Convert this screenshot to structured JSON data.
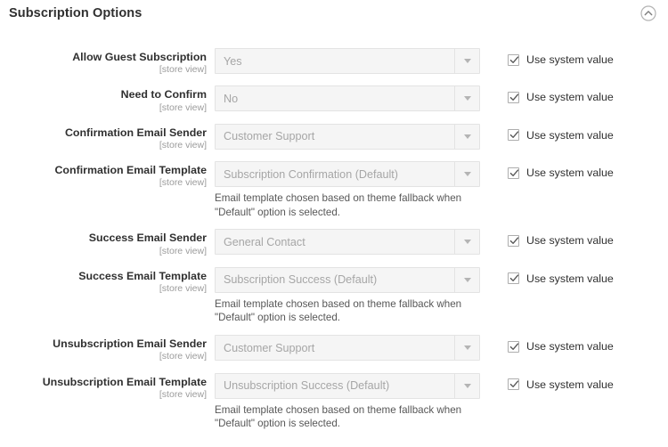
{
  "section": {
    "title": "Subscription Options",
    "collapse_icon": "chevron-up-circle-icon",
    "collapsed": false
  },
  "scope_label": "[store view]",
  "checkbox_label": "Use system value",
  "template_note": "Email template chosen based on theme fallback when \"Default\" option is selected.",
  "colors": {
    "text": "#303030",
    "muted": "#9b9b9b",
    "select_bg": "#f5f5f5",
    "select_border": "#e3e3e3",
    "select_value": "#a6a6a6",
    "note": "#575757"
  },
  "fields": [
    {
      "label": "Allow Guest Subscription",
      "scope": "[store view]",
      "value": "Yes",
      "note": null,
      "use_system_value": true,
      "checkbox_label": "Use system value"
    },
    {
      "label": "Need to Confirm",
      "scope": "[store view]",
      "value": "No",
      "note": null,
      "use_system_value": true,
      "checkbox_label": "Use system value"
    },
    {
      "label": "Confirmation Email Sender",
      "scope": "[store view]",
      "value": "Customer Support",
      "note": null,
      "use_system_value": true,
      "checkbox_label": "Use system value"
    },
    {
      "label": "Confirmation Email Template",
      "scope": "[store view]",
      "value": "Subscription Confirmation (Default)",
      "note": "Email template chosen based on theme fallback when \"Default\" option is selected.",
      "use_system_value": true,
      "checkbox_label": "Use system value"
    },
    {
      "label": "Success Email Sender",
      "scope": "[store view]",
      "value": "General Contact",
      "note": null,
      "use_system_value": true,
      "checkbox_label": "Use system value"
    },
    {
      "label": "Success Email Template",
      "scope": "[store view]",
      "value": "Subscription Success (Default)",
      "note": "Email template chosen based on theme fallback when \"Default\" option is selected.",
      "use_system_value": true,
      "checkbox_label": "Use system value"
    },
    {
      "label": "Unsubscription Email Sender",
      "scope": "[store view]",
      "value": "Customer Support",
      "note": null,
      "use_system_value": true,
      "checkbox_label": "Use system value"
    },
    {
      "label": "Unsubscription Email Template",
      "scope": "[store view]",
      "value": "Unsubscription Success (Default)",
      "note": "Email template chosen based on theme fallback when \"Default\" option is selected.",
      "use_system_value": true,
      "checkbox_label": "Use system value"
    }
  ]
}
